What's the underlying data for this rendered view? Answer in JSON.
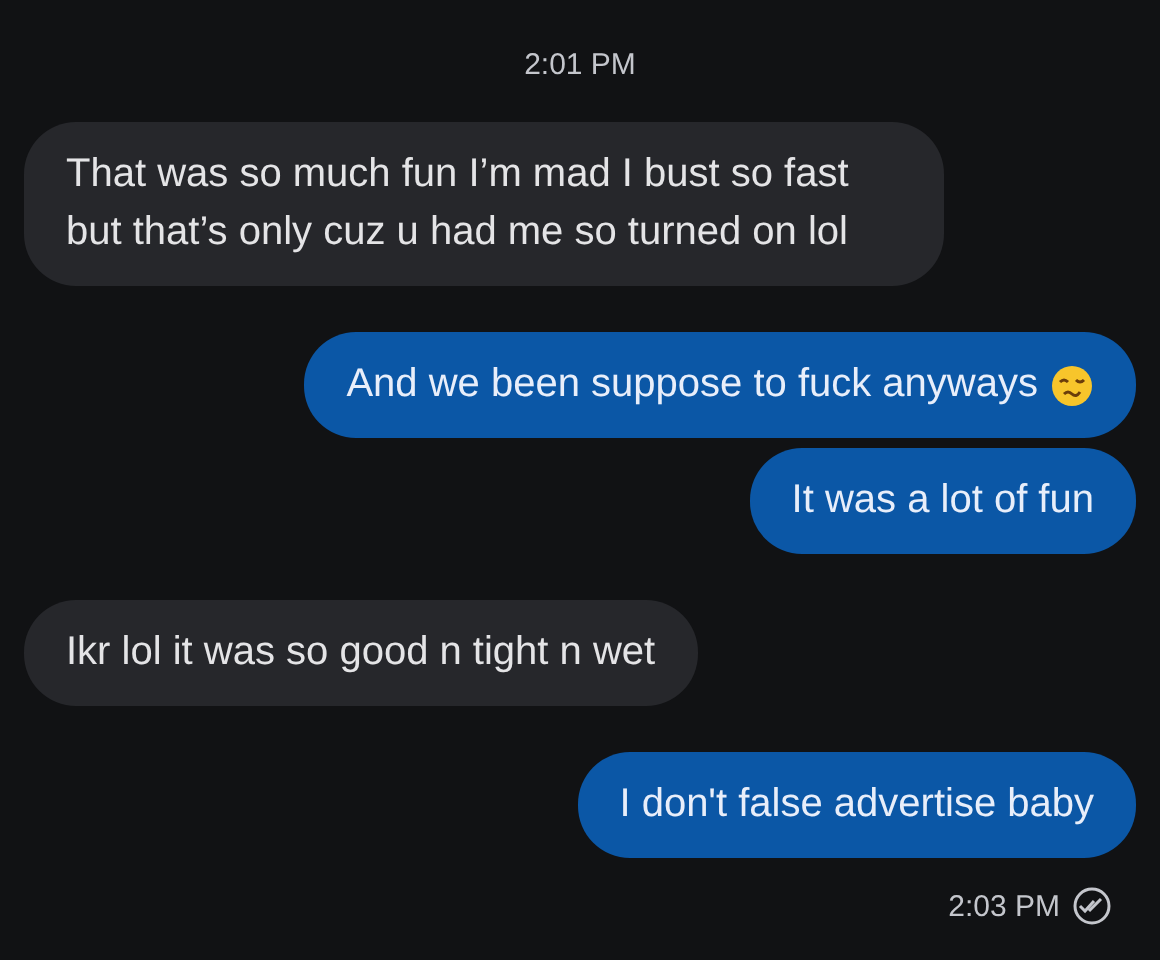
{
  "timestamp": "2:01 PM",
  "messages": [
    {
      "kind": "incoming",
      "text": "That was so much fun I’m mad I bust so fast but that’s only cuz u had me so turned on lol"
    },
    {
      "kind": "outgoing",
      "text": "And we been suppose to fuck anyways",
      "emoji": true
    },
    {
      "kind": "outgoing",
      "text": "It was a lot of fun"
    },
    {
      "kind": "incoming",
      "text": "Ikr lol it was so good n tight n wet"
    },
    {
      "kind": "outgoing",
      "text": "I don't false advertise baby"
    }
  ],
  "footer": {
    "time": "2:03 PM",
    "read": true
  }
}
